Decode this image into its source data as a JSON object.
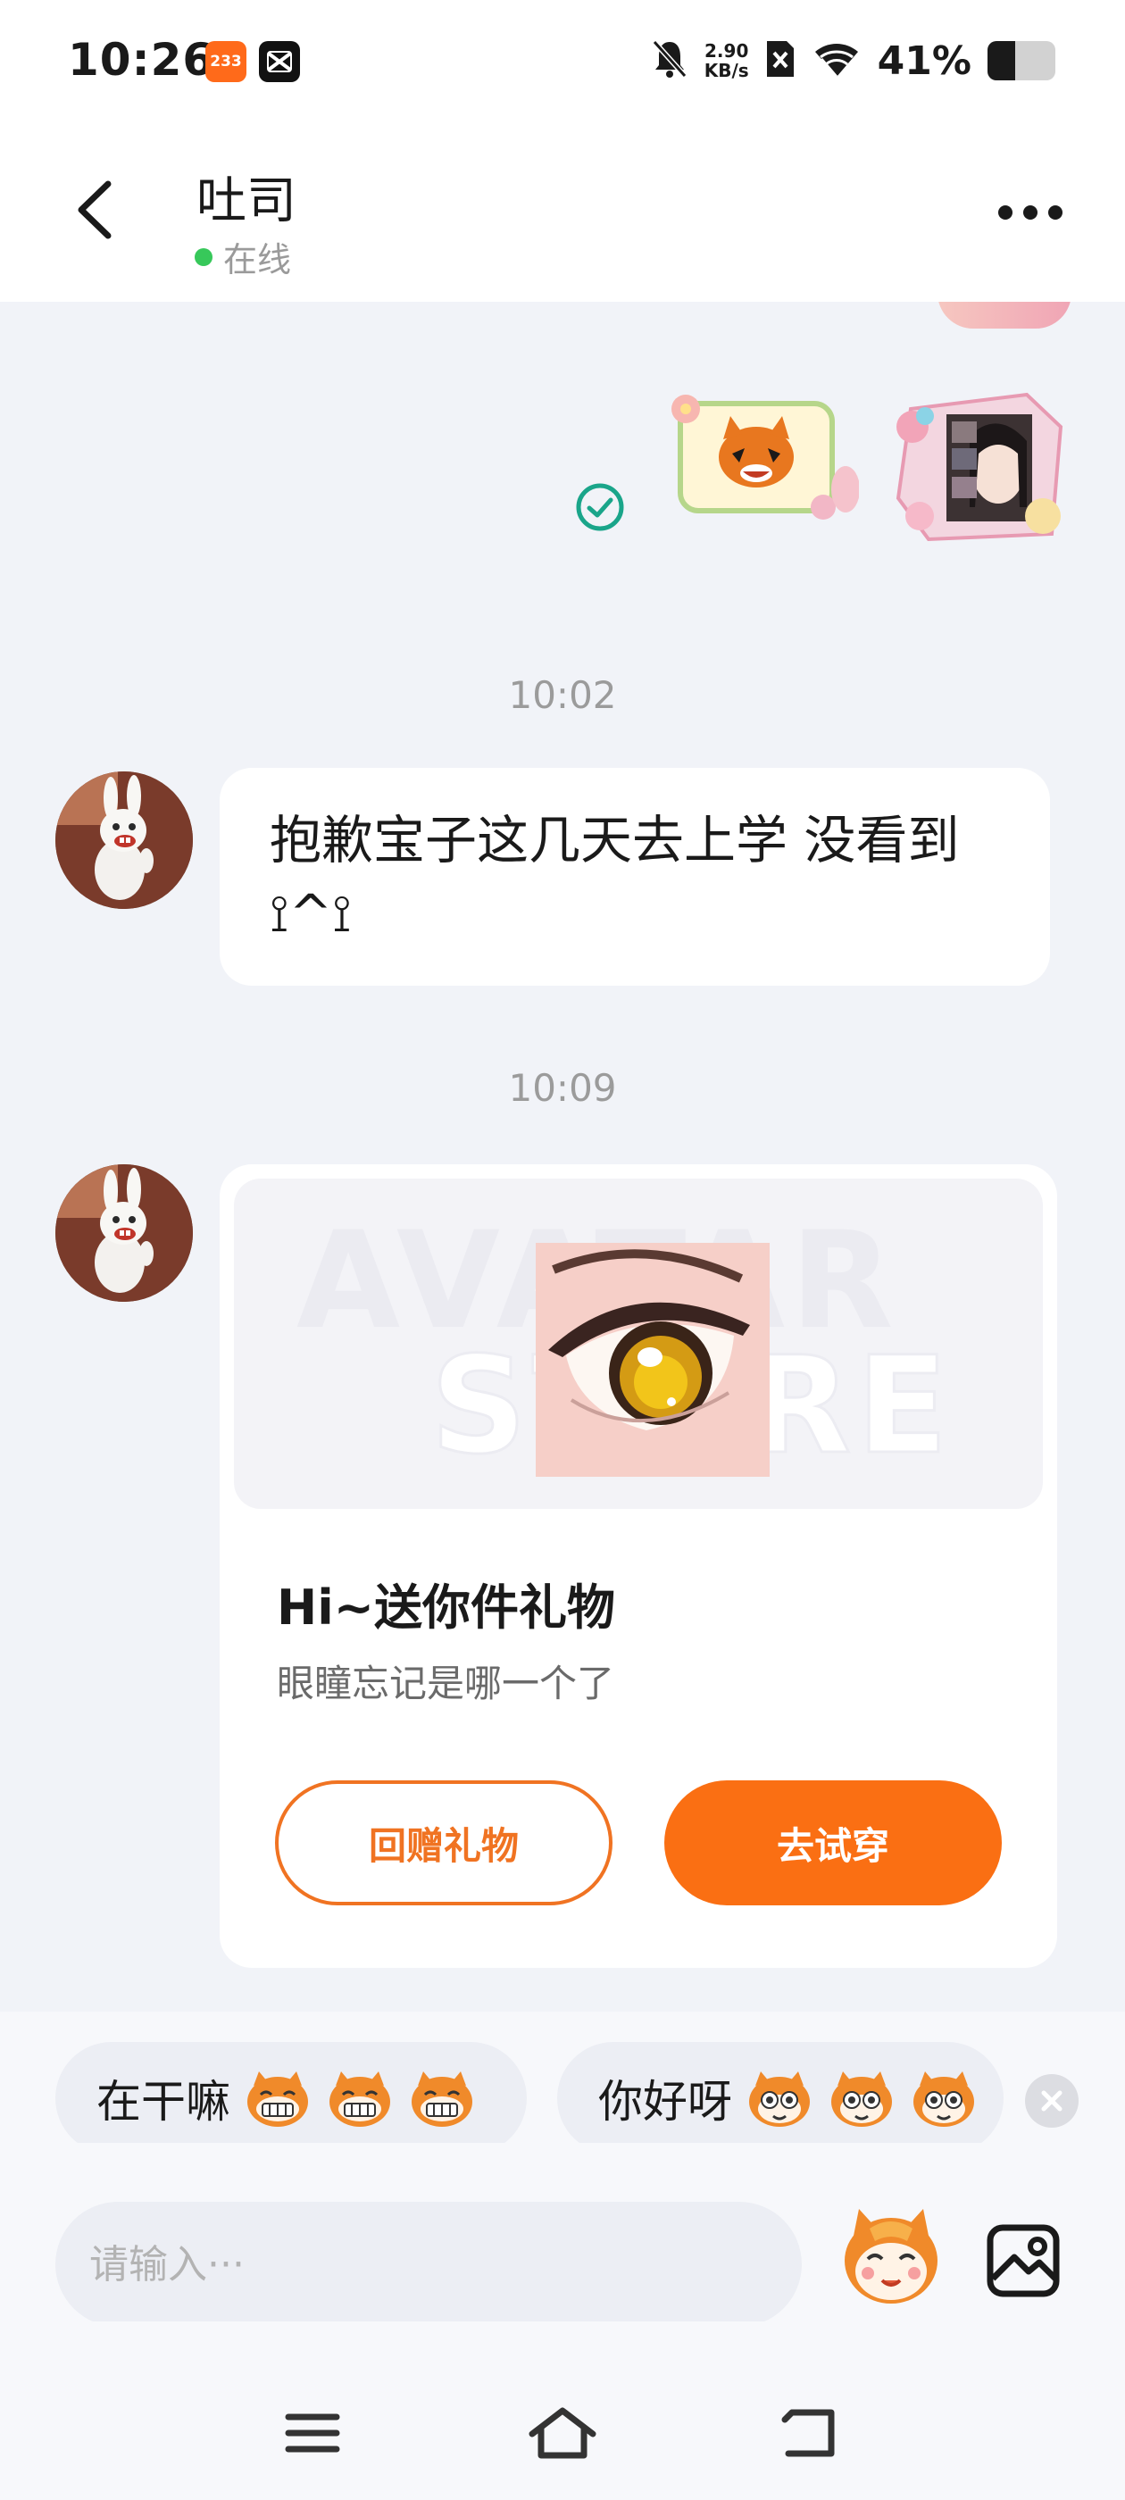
{
  "status_bar": {
    "time": "10:26",
    "app_badge": "233",
    "net_speed_value": "2.90",
    "net_speed_unit": "KB/s",
    "battery_percent": "41%",
    "battery_level": 0.41,
    "icons": [
      "app-233-icon",
      "capcut-icon",
      "mute-icon",
      "no-sim-icon",
      "wifi-icon",
      "battery-icon"
    ]
  },
  "header": {
    "name": "吐司",
    "status": "在线",
    "status_color": "#37c85a"
  },
  "messages": {
    "timestamp_1": "10:02",
    "text_message": "抱歉宝子这几天去上学 没看到 ⟟^⟟",
    "timestamp_2": "10:09",
    "gift": {
      "title": "Hi~送你件礼物",
      "subtitle": "眼瞳忘记是哪一个了",
      "return_gift_label": "回赠礼物",
      "try_on_label": "去试穿",
      "watermark_line1": "AVATAR",
      "watermark_line2": "STORE"
    }
  },
  "quick_replies": {
    "chip_1": "在干嘛",
    "chip_2": "你好呀"
  },
  "input": {
    "placeholder": "请输入···"
  },
  "colors": {
    "accent": "#fa6f13",
    "background": "#f1f3f8",
    "read_check": "#1aa58a"
  }
}
